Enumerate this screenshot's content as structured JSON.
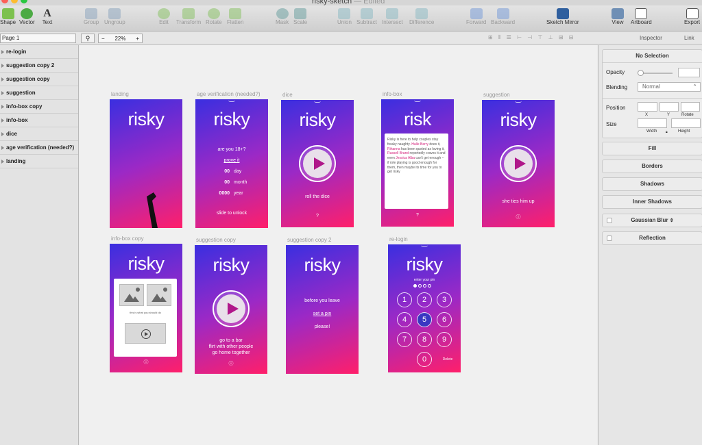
{
  "window": {
    "title": "risky-sketch",
    "status": "— Edited"
  },
  "toolbar": {
    "shape": "Shape",
    "vector": "Vector",
    "text": "Text",
    "group": "Group",
    "ungroup": "Ungroup",
    "edit": "Edit",
    "transform": "Transform",
    "rotate": "Rotate",
    "flatten": "Flatten",
    "mask": "Mask",
    "scale": "Scale",
    "union": "Union",
    "subtract": "Subtract",
    "intersect": "Intersect",
    "difference": "Difference",
    "forward": "Forward",
    "backward": "Backward",
    "mirror": "Sketch Mirror",
    "view": "View",
    "artboard": "Artboard",
    "export": "Export"
  },
  "subbar": {
    "page": "Page 1",
    "zoom": "22%",
    "zoom_minus": "−",
    "zoom_plus": "+",
    "inspector": "Inspector",
    "link": "Link"
  },
  "layers": [
    "re-login",
    "suggestion copy 2",
    "suggestion copy",
    "suggestion",
    "info-box copy",
    "info-box",
    "dice",
    "age verification (needed?)",
    "landing"
  ],
  "artboards": {
    "landing": {
      "label": "landing",
      "logo": "risky"
    },
    "age": {
      "label": "age verification (needed?)",
      "logo": "risky",
      "question": "are you 18+?",
      "prove": "prove it",
      "rows": [
        {
          "v": "00",
          "u": "day"
        },
        {
          "v": "00",
          "u": "month"
        },
        {
          "v": "0000",
          "u": "year"
        }
      ],
      "slide": "slide to unlock"
    },
    "dice": {
      "label": "dice",
      "logo": "risky",
      "caption": "roll the dice",
      "q": "?"
    },
    "infobox": {
      "label": "info-box",
      "logo": "risk",
      "t1": "Risky is here to help couples stay freaky naughty. ",
      "h1": "Halle Berry",
      "t2": " does it, ",
      "h2": "Rihanna",
      "t3": " has been quoted as loving it, ",
      "h3": "Russell Brand",
      "t4": " reportedly craves it and even ",
      "h4": "Jessica Alba",
      "t5": " can't get enough -- if role playing is good enough for them, then maybe its time for you to get risky",
      "q": "?"
    },
    "suggestion": {
      "label": "suggestion",
      "logo": "risky",
      "caption": "she ties him up",
      "info": "ⓘ"
    },
    "infoboxcopy": {
      "label": "info-box copy",
      "logo": "risky",
      "caption": "this is what you should do",
      "info": "ⓘ"
    },
    "sugcopy": {
      "label": "suggestion copy",
      "logo": "risky",
      "l1": "go to a bar",
      "l2": "flirt with other people",
      "l3": "go home together",
      "info": "ⓘ"
    },
    "sugcopy2": {
      "label": "suggestion copy 2",
      "logo": "risky",
      "l1": "before you leave",
      "l2": "set a pin",
      "l3": "please!"
    },
    "relogin": {
      "label": "re-login",
      "logo": "risky",
      "prompt": "enter your pin",
      "keys": [
        "1",
        "2",
        "3",
        "4",
        "5",
        "6",
        "7",
        "8",
        "9",
        "0"
      ],
      "delete": "Delete"
    }
  },
  "inspector": {
    "selection": "No Selection",
    "opacity": "Opacity",
    "blending": "Blending",
    "blend_value": "Normal",
    "position": "Position",
    "size": "Size",
    "x": "X",
    "y": "Y",
    "rotate": "Rotate",
    "width": "Width",
    "height": "Height",
    "fill": "Fill",
    "borders": "Borders",
    "shadows": "Shadows",
    "inner_shadows": "Inner Shadows",
    "blur": "Gaussian Blur",
    "reflection": "Reflection"
  }
}
